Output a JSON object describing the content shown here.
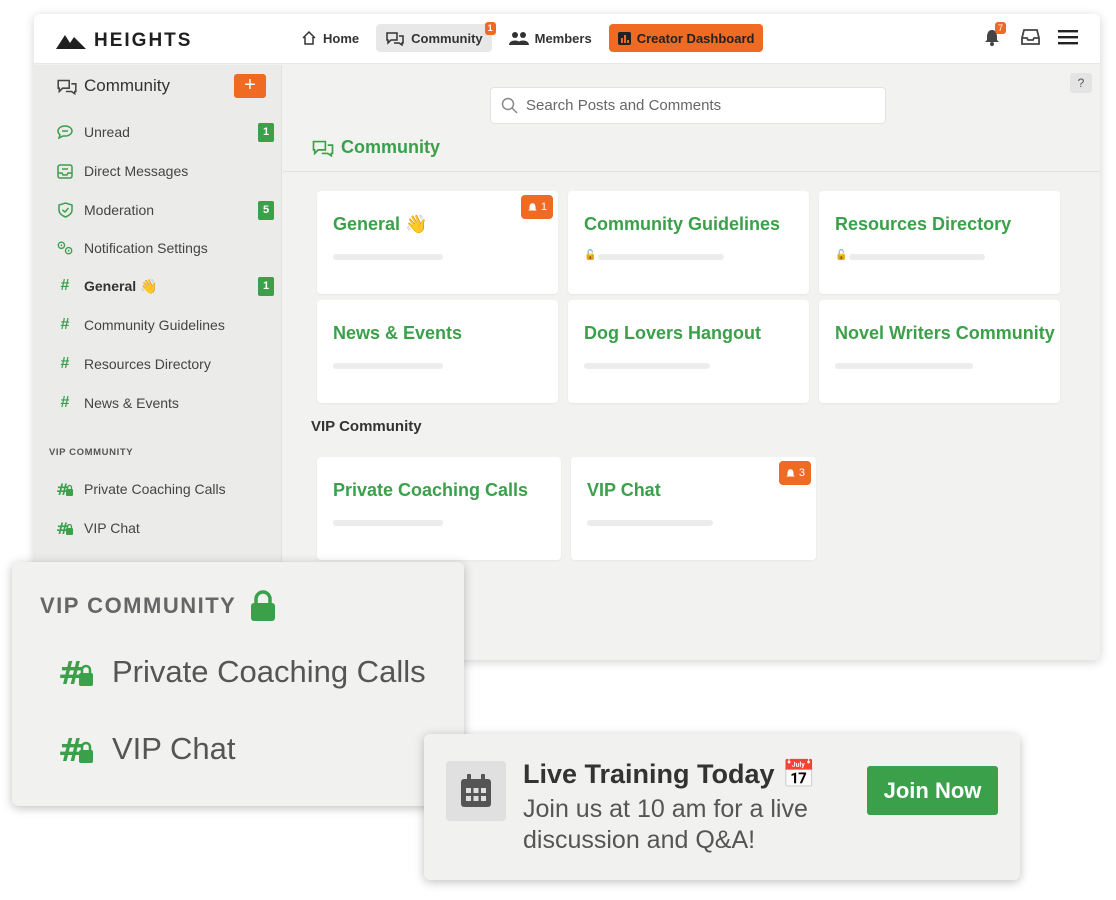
{
  "brand": {
    "name": "HEIGHTS"
  },
  "nav": {
    "home": "Home",
    "community": "Community",
    "community_badge": "1",
    "members": "Members",
    "creator": "Creator Dashboard",
    "notifications_badge": "7"
  },
  "sidebar": {
    "title": "Community",
    "add_label": "+",
    "items": [
      {
        "label": "Unread",
        "badge": "1",
        "icon": "chat-bubble-icon"
      },
      {
        "label": "Direct Messages",
        "icon": "inbox-icon"
      },
      {
        "label": "Moderation",
        "badge": "5",
        "icon": "shield-check-icon"
      },
      {
        "label": "Notification Settings",
        "icon": "gears-icon"
      },
      {
        "label": "General 👋",
        "badge": "1",
        "icon": "hash-icon"
      },
      {
        "label": "Community Guidelines",
        "icon": "hash-icon"
      },
      {
        "label": "Resources Directory",
        "icon": "hash-icon"
      },
      {
        "label": "News & Events",
        "icon": "hash-icon"
      }
    ],
    "section_label": "VIP COMMUNITY",
    "vip_items": [
      {
        "label": "Private Coaching Calls",
        "icon": "hash-lock-icon"
      },
      {
        "label": "VIP Chat",
        "icon": "hash-lock-icon"
      }
    ]
  },
  "main": {
    "search_placeholder": "Search Posts and Comments",
    "help": "?",
    "title": "Community",
    "cards": [
      {
        "title": "General 👋",
        "badge": "1"
      },
      {
        "title": "Community Guidelines",
        "locked": true
      },
      {
        "title": "Resources Directory",
        "locked": true
      },
      {
        "title": "News & Events"
      },
      {
        "title": "Dog Lovers Hangout"
      },
      {
        "title": "Novel Writers Community"
      }
    ],
    "vip_title": "VIP Community",
    "vip_cards": [
      {
        "title": "Private Coaching Calls"
      },
      {
        "title": "VIP Chat",
        "badge": "3"
      }
    ]
  },
  "overlay": {
    "title": "VIP COMMUNITY",
    "items": [
      "Private Coaching Calls",
      "VIP Chat"
    ]
  },
  "live": {
    "title": "Live Training Today 📅",
    "body": "Join us at 10 am for a live discussion and Q&A!",
    "button": "Join Now"
  },
  "colors": {
    "accent": "#ef6a22",
    "green": "#3aa04a"
  }
}
